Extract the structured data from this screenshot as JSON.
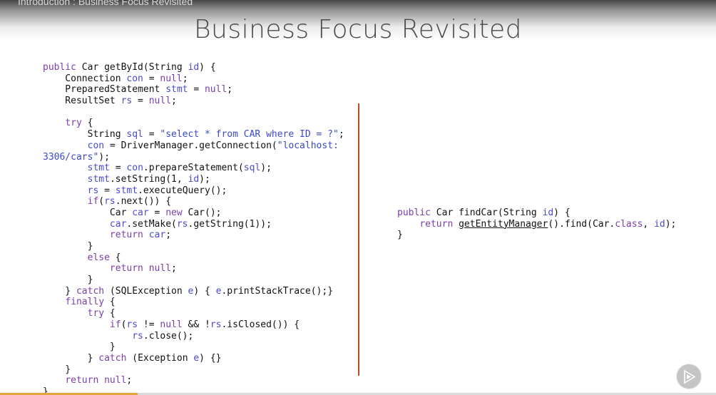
{
  "header": {
    "course_title": "Introduction : Business Focus Revisited",
    "slide_title": "Business Focus Revisited"
  },
  "code_left": [
    [
      {
        "t": "kw",
        "v": "public"
      },
      {
        "t": "",
        "v": " Car getById(String "
      },
      {
        "t": "vr",
        "v": "id"
      },
      {
        "t": "",
        "v": ") {"
      }
    ],
    [
      {
        "t": "",
        "v": "    Connection "
      },
      {
        "t": "vr",
        "v": "con"
      },
      {
        "t": "",
        "v": " = "
      },
      {
        "t": "kw",
        "v": "null"
      },
      {
        "t": "",
        "v": ";"
      }
    ],
    [
      {
        "t": "",
        "v": "    PreparedStatement "
      },
      {
        "t": "vr",
        "v": "stmt"
      },
      {
        "t": "",
        "v": " = "
      },
      {
        "t": "kw",
        "v": "null"
      },
      {
        "t": "",
        "v": ";"
      }
    ],
    [
      {
        "t": "",
        "v": "    ResultSet "
      },
      {
        "t": "vr",
        "v": "rs"
      },
      {
        "t": "",
        "v": " = "
      },
      {
        "t": "kw",
        "v": "null"
      },
      {
        "t": "",
        "v": ";"
      }
    ],
    [],
    [
      {
        "t": "",
        "v": "    "
      },
      {
        "t": "kw",
        "v": "try"
      },
      {
        "t": "",
        "v": " {"
      }
    ],
    [
      {
        "t": "",
        "v": "        String "
      },
      {
        "t": "vr",
        "v": "sql"
      },
      {
        "t": "",
        "v": " = "
      },
      {
        "t": "st",
        "v": "\"select * from CAR where ID = ?\""
      },
      {
        "t": "",
        "v": ";"
      }
    ],
    [
      {
        "t": "",
        "v": "        "
      },
      {
        "t": "vr",
        "v": "con"
      },
      {
        "t": "",
        "v": " = DriverManager.getConnection("
      },
      {
        "t": "st",
        "v": "\"localhost:"
      }
    ],
    [
      {
        "t": "st",
        "v": "3306/cars\""
      },
      {
        "t": "",
        "v": ");"
      }
    ],
    [
      {
        "t": "",
        "v": "        "
      },
      {
        "t": "vr",
        "v": "stmt"
      },
      {
        "t": "",
        "v": " = "
      },
      {
        "t": "vr",
        "v": "con"
      },
      {
        "t": "",
        "v": ".prepareStatement("
      },
      {
        "t": "vr",
        "v": "sql"
      },
      {
        "t": "",
        "v": ");"
      }
    ],
    [
      {
        "t": "",
        "v": "        "
      },
      {
        "t": "vr",
        "v": "stmt"
      },
      {
        "t": "",
        "v": ".setString(1, "
      },
      {
        "t": "vr",
        "v": "id"
      },
      {
        "t": "",
        "v": ");"
      }
    ],
    [
      {
        "t": "",
        "v": "        "
      },
      {
        "t": "vr",
        "v": "rs"
      },
      {
        "t": "",
        "v": " = "
      },
      {
        "t": "vr",
        "v": "stmt"
      },
      {
        "t": "",
        "v": ".executeQuery();"
      }
    ],
    [
      {
        "t": "",
        "v": "        "
      },
      {
        "t": "kw",
        "v": "if"
      },
      {
        "t": "",
        "v": "("
      },
      {
        "t": "vr",
        "v": "rs"
      },
      {
        "t": "",
        "v": ".next()) {"
      }
    ],
    [
      {
        "t": "",
        "v": "            Car "
      },
      {
        "t": "vr",
        "v": "car"
      },
      {
        "t": "",
        "v": " = "
      },
      {
        "t": "kw",
        "v": "new"
      },
      {
        "t": "",
        "v": " Car();"
      }
    ],
    [
      {
        "t": "",
        "v": "            "
      },
      {
        "t": "vr",
        "v": "car"
      },
      {
        "t": "",
        "v": ".setMake("
      },
      {
        "t": "vr",
        "v": "rs"
      },
      {
        "t": "",
        "v": ".getString(1));"
      }
    ],
    [
      {
        "t": "",
        "v": "            "
      },
      {
        "t": "kw",
        "v": "return"
      },
      {
        "t": "",
        "v": " "
      },
      {
        "t": "vr",
        "v": "car"
      },
      {
        "t": "",
        "v": ";"
      }
    ],
    [
      {
        "t": "",
        "v": "        }"
      }
    ],
    [
      {
        "t": "",
        "v": "        "
      },
      {
        "t": "kw",
        "v": "else"
      },
      {
        "t": "",
        "v": " {"
      }
    ],
    [
      {
        "t": "",
        "v": "            "
      },
      {
        "t": "kw",
        "v": "return"
      },
      {
        "t": "",
        "v": " "
      },
      {
        "t": "kw",
        "v": "null"
      },
      {
        "t": "",
        "v": ";"
      }
    ],
    [
      {
        "t": "",
        "v": "        }"
      }
    ],
    [
      {
        "t": "",
        "v": "    } "
      },
      {
        "t": "kw",
        "v": "catch"
      },
      {
        "t": "",
        "v": " (SQLException "
      },
      {
        "t": "vr",
        "v": "e"
      },
      {
        "t": "",
        "v": ") { "
      },
      {
        "t": "vr",
        "v": "e"
      },
      {
        "t": "",
        "v": ".printStackTrace();}"
      }
    ],
    [
      {
        "t": "",
        "v": "    "
      },
      {
        "t": "kw",
        "v": "finally"
      },
      {
        "t": "",
        "v": " {"
      }
    ],
    [
      {
        "t": "",
        "v": "        "
      },
      {
        "t": "kw",
        "v": "try"
      },
      {
        "t": "",
        "v": " {"
      }
    ],
    [
      {
        "t": "",
        "v": "            "
      },
      {
        "t": "kw",
        "v": "if"
      },
      {
        "t": "",
        "v": "("
      },
      {
        "t": "vr",
        "v": "rs"
      },
      {
        "t": "",
        "v": " != "
      },
      {
        "t": "kw",
        "v": "null"
      },
      {
        "t": "",
        "v": " && !"
      },
      {
        "t": "vr",
        "v": "rs"
      },
      {
        "t": "",
        "v": ".isClosed()) {"
      }
    ],
    [
      {
        "t": "",
        "v": "                "
      },
      {
        "t": "vr",
        "v": "rs"
      },
      {
        "t": "",
        "v": ".close();"
      }
    ],
    [
      {
        "t": "",
        "v": "            }"
      }
    ],
    [
      {
        "t": "",
        "v": "        } "
      },
      {
        "t": "kw",
        "v": "catch"
      },
      {
        "t": "",
        "v": " (Exception "
      },
      {
        "t": "vr",
        "v": "e"
      },
      {
        "t": "",
        "v": ") {}"
      }
    ],
    [
      {
        "t": "",
        "v": "    }"
      }
    ],
    [
      {
        "t": "",
        "v": "    "
      },
      {
        "t": "kw",
        "v": "return"
      },
      {
        "t": "",
        "v": " "
      },
      {
        "t": "kw",
        "v": "null"
      },
      {
        "t": "",
        "v": ";"
      }
    ],
    [
      {
        "t": "",
        "v": "}"
      }
    ]
  ],
  "code_right": [
    [
      {
        "t": "kw",
        "v": "public"
      },
      {
        "t": "",
        "v": " Car findCar(String "
      },
      {
        "t": "vr",
        "v": "id"
      },
      {
        "t": "",
        "v": ") {"
      }
    ],
    [
      {
        "t": "",
        "v": "    "
      },
      {
        "t": "kw",
        "v": "return"
      },
      {
        "t": "",
        "v": " "
      },
      {
        "t": "ul",
        "v": "getEntityManager"
      },
      {
        "t": "",
        "v": "().find(Car."
      },
      {
        "t": "kw",
        "v": "class"
      },
      {
        "t": "",
        "v": ", "
      },
      {
        "t": "vr",
        "v": "id"
      },
      {
        "t": "",
        "v": ");"
      }
    ],
    [
      {
        "t": "",
        "v": "}"
      }
    ]
  ],
  "player": {
    "progress": 0.192,
    "play_icon": "play-icon",
    "colors": {
      "progress_fill": "#e6a23c",
      "divider": "#b24e1b",
      "keyword": "#7b3ea8",
      "variable": "#4a4ad0",
      "string": "#3a49c8"
    }
  }
}
